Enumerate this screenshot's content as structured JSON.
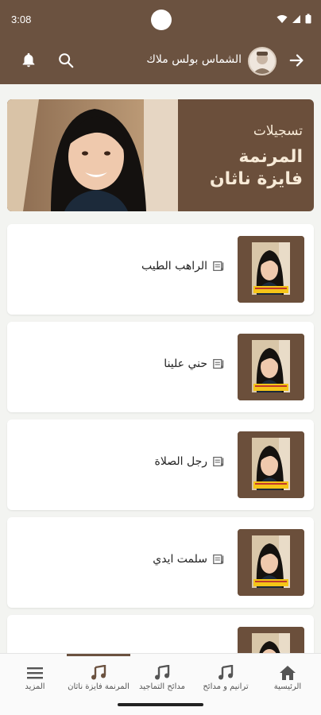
{
  "status": {
    "time": "3:08"
  },
  "app_bar": {
    "user_name": "الشماس بولس ملاك"
  },
  "banner": {
    "title": "تسجيلات",
    "line1": "المرنمة",
    "line2": "فايزة ناثان"
  },
  "songs": [
    {
      "title": "الراهب الطيب"
    },
    {
      "title": "حني علينا"
    },
    {
      "title": "رجل الصلاة"
    },
    {
      "title": "سلمت ايدي"
    },
    {
      "title": ""
    }
  ],
  "bottom_nav": [
    {
      "label": "المزيد",
      "icon": "menu-icon"
    },
    {
      "label": "المرنمة فايزة ناثان",
      "icon": "music-note-icon"
    },
    {
      "label": "مدائح التماجيد",
      "icon": "music-note-icon"
    },
    {
      "label": "ترانيم و مدائح",
      "icon": "music-note-icon"
    },
    {
      "label": "الرئيسية",
      "icon": "home-icon"
    }
  ],
  "colors": {
    "brand": "#6b5240",
    "background": "#f3f4f1"
  }
}
